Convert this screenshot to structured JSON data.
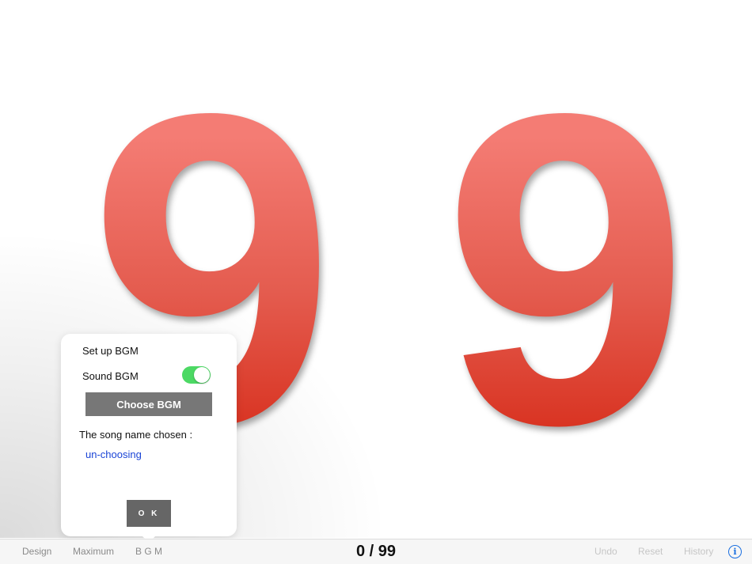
{
  "display": {
    "digits": [
      "9",
      "9"
    ]
  },
  "bgm_popover": {
    "title": "Set up BGM",
    "sound_label": "Sound BGM",
    "sound_on": true,
    "choose_button": "Choose BGM",
    "song_label": "The song name chosen :",
    "song_name": "un-choosing",
    "ok_button": "O K"
  },
  "bottom_bar": {
    "left_items": [
      "Design",
      "Maximum",
      "B G M"
    ],
    "counter": "0 / 99",
    "right_items": [
      "Undo",
      "Reset",
      "History"
    ],
    "info_icon": "i"
  },
  "colors": {
    "digit_top": "#f47c74",
    "digit_bottom": "#d8311f",
    "toggle_on": "#4cd964",
    "link_blue": "#1a44d6"
  }
}
